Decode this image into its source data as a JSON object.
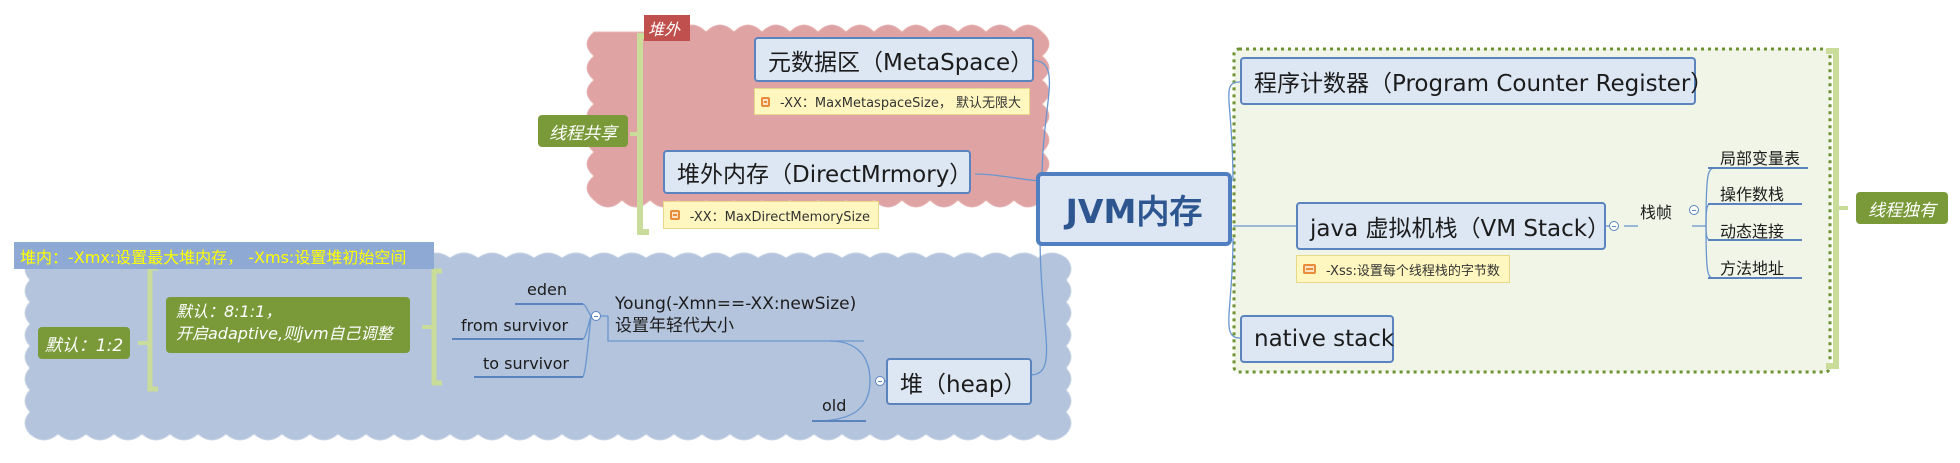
{
  "central": {
    "label": "JVM内存"
  },
  "off_heap": {
    "tag": "堆外",
    "metaspace": {
      "label": "元数据区（MetaSpace）",
      "note": "-XX：MaxMetaspaceSize，  默认无限大"
    },
    "direct": {
      "label": "堆外内存（DirectMrmory）",
      "note": "-XX：MaxDirectMemorySize"
    }
  },
  "shared_tag": "线程共享",
  "heap_region": {
    "banner": "堆内：-Xmx:设置最大堆内存，  -Xms:设置堆初始空间",
    "ratio_tag": "默认：1:2",
    "survivor_tag": [
      "默认：8:1:1，",
      "开启adaptive,则jvm自己调整"
    ],
    "heap": {
      "label": "堆（heap）"
    },
    "young": {
      "line1": "Young(-Xmn==-XX:newSize)",
      "line2": "设置年轻代大小"
    },
    "young_children": [
      "eden",
      "from survivor",
      "to survivor"
    ],
    "old": "old"
  },
  "private_region": {
    "tag": "线程独有",
    "pc": {
      "label": "程序计数器（Program Counter Register）"
    },
    "vm_stack": {
      "label": "java 虚拟机栈（VM Stack）",
      "note": "-Xss:设置每个线程栈的字节数",
      "frame_label": "栈帧",
      "frame_items": [
        "局部变量表",
        "操作数栈",
        "动态连接",
        "方法地址"
      ]
    },
    "native": {
      "label": "native stack"
    }
  },
  "colors": {
    "off_heap_bg": "#e0a3a3",
    "heap_bg": "#b4c4dd",
    "private_bg": "#f1f5e8",
    "boundary_green": "#6c9432",
    "topic_border": "#5b84bf",
    "tag_green": "#7a9a3a"
  }
}
